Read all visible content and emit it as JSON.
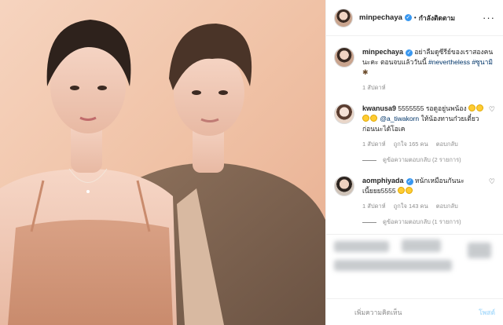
{
  "header": {
    "username": "minpechaya",
    "follow_status": "กำลังติดตาม"
  },
  "caption": {
    "username": "minpechaya",
    "text": "อย่าลืมดูซีรีย์ของเราสองคนนะคะ ตอนจบแล้ววันนี้",
    "hashtags": "#nevertheless #ซูนามิ",
    "time": "1 สัปดาห์"
  },
  "comments": [
    {
      "username": "kwanusa9",
      "text_start": "5555555 รอดูอยู่นพน้อง",
      "mention": "@a_tiwakorn",
      "text_end": "ให้น้องทานก๋วยเตี๋ยวก่อนนะได้โอเค",
      "time": "1 สัปดาห์",
      "likes": "ถูกใจ 165 คน",
      "reply": "ตอบกลับ",
      "view_replies": "ดูข้อความตอบกลับ (2 รายการ)"
    },
    {
      "username": "aomphiyada",
      "text": "หน้กเหมือนกันนะเนี้ยยย5555",
      "time": "1 สัปดาห์",
      "likes": "ถูกใจ 143 คน",
      "reply": "ตอบกลับ",
      "view_replies": "ดูข้อความตอบกลับ (1 รายการ)"
    }
  ],
  "composer": {
    "placeholder": "เพิ่มความคิดเห็น",
    "post_label": "โพสต์"
  },
  "colors": {
    "verified": "#3897f0",
    "secondary_text": "#8e8e8e",
    "post_button_disabled": "#b2dffc",
    "photo_background": "#f0c9b0"
  },
  "icons": [
    "verified-badge-icon",
    "more-options-icon",
    "heart-icon",
    "emoji-icon"
  ]
}
